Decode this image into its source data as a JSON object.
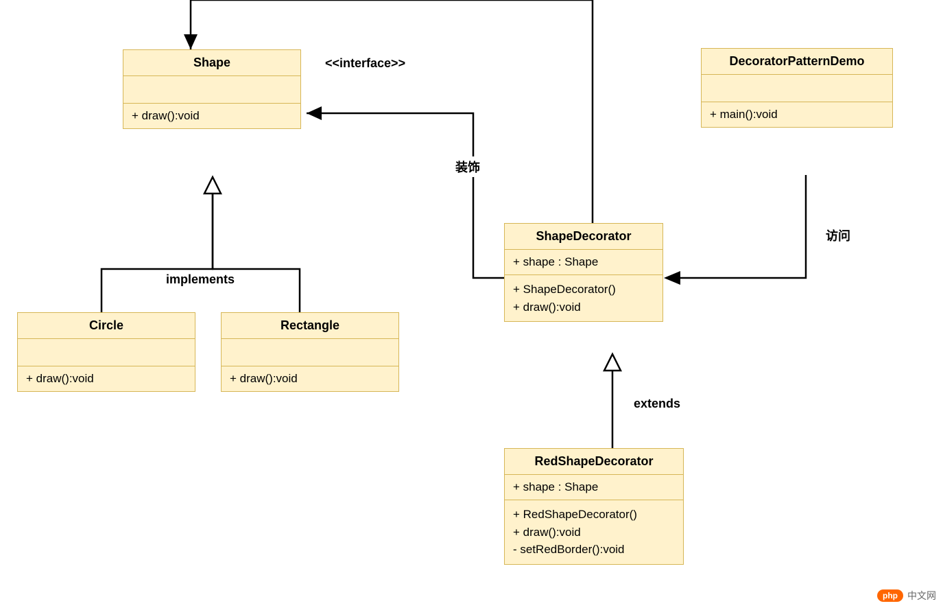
{
  "classes": {
    "shape": {
      "name": "Shape",
      "methods": "+ draw():void"
    },
    "circle": {
      "name": "Circle",
      "methods": "+ draw():void"
    },
    "rectangle": {
      "name": "Rectangle",
      "methods": "+ draw():void"
    },
    "shapeDecorator": {
      "name": "ShapeDecorator",
      "attributes": "+ shape : Shape",
      "method1": "+ ShapeDecorator()",
      "method2": "+ draw():void"
    },
    "redShapeDecorator": {
      "name": "RedShapeDecorator",
      "attributes": "+ shape : Shape",
      "method1": "+ RedShapeDecorator()",
      "method2": "+ draw():void",
      "method3": "- setRedBorder():void"
    },
    "demo": {
      "name": "DecoratorPatternDemo",
      "methods": "+ main():void"
    }
  },
  "labels": {
    "interface": "<<interface>>",
    "implements": "implements",
    "extends": "extends",
    "decorate": "装饰",
    "access": "访问"
  },
  "watermark": {
    "badge": "php",
    "text": "中文网"
  }
}
